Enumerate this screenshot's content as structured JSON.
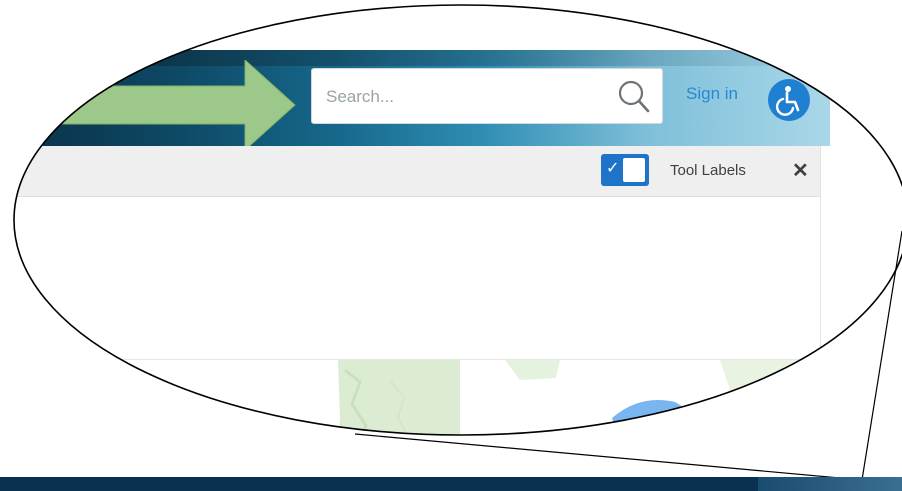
{
  "search": {
    "placeholder": "Search..."
  },
  "header": {
    "sign_in_label": "Sign in"
  },
  "toolbar": {
    "tool_labels_label": "Tool Labels",
    "tool_labels_enabled": true,
    "close_glyph": "✕"
  },
  "icons": {
    "search": "magnifier-icon",
    "accessibility": "wheelchair-icon",
    "checkbox": "check-icon",
    "close": "close-icon",
    "arrow": "green-arrow"
  },
  "colors": {
    "header_dark": "#0b2f45",
    "header_light": "#a9d7e8",
    "arrow_green": "#9cc98a",
    "accent_blue": "#1f7fd1",
    "sign_in_blue": "#2b86d3",
    "map_green": "#dcecd3",
    "map_water": "#79b6f0",
    "bottom_bar": "#0b3150"
  }
}
